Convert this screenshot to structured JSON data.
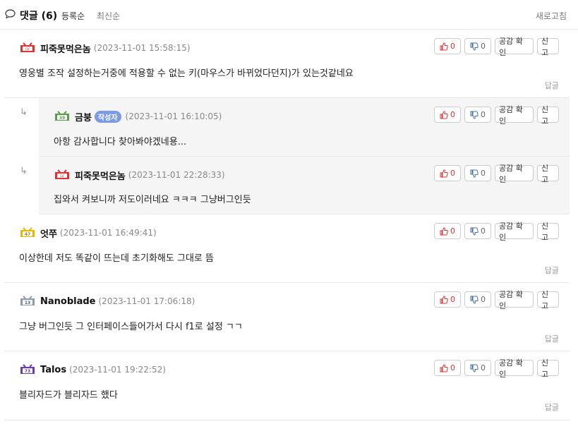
{
  "header": {
    "title": "댓글 (6)",
    "sort_registered": "등록순",
    "sort_latest": "최신순",
    "refresh": "새로고침"
  },
  "labels": {
    "empathy": "공감 확인",
    "report": "신고",
    "reply": "답글",
    "author_badge": "작성자"
  },
  "comments": [
    {
      "level": "LV",
      "level_color": "#d33",
      "nick": "피죽못먹은놈",
      "date": "(2023-11-01 15:58:15)",
      "text": "영웅별 조작 설정하는거중에 적용할 수 없는 키(마우스가 바뀌었다던지)가 있는것같네요",
      "up": "0",
      "down": "0"
    },
    {
      "level": "39",
      "level_color": "#5a9e4a",
      "nick": "금붕",
      "badge": "작성자",
      "date": "(2023-11-01 16:10:05)",
      "text": "아항 감사합니다 찾아봐야겠네용...",
      "up": "0",
      "down": "0"
    },
    {
      "level": "LV",
      "level_color": "#d33",
      "nick": "피죽못먹은놈",
      "date": "(2023-11-01 22:28:33)",
      "text": "집와서 켜보니까 저도이러네요 ㅋㅋㅋ 그냥버그인듯",
      "up": "0",
      "down": "0"
    },
    {
      "level": "47",
      "level_color": "#d9a400",
      "nick": "엇쭈",
      "date": "(2023-11-01 16:49:41)",
      "text": "이상한데 저도 똑같이 뜨는데 초기화해도 그대로 뜸",
      "up": "0",
      "down": "0"
    },
    {
      "level": "13",
      "level_color": "#6b7f9a",
      "nick": "Nanoblade",
      "date": "(2023-11-01 17:06:18)",
      "text": "그냥 버그인듯 그 인터페이스들어가서 다시 f1로 설정 ㄱㄱ",
      "up": "0",
      "down": "0"
    },
    {
      "level": "73",
      "level_color": "#6a3cb0",
      "nick": "Talos",
      "date": "(2023-11-01 19:22:52)",
      "text": "블리자드가 블리자드 했다",
      "up": "0",
      "down": "0"
    }
  ]
}
